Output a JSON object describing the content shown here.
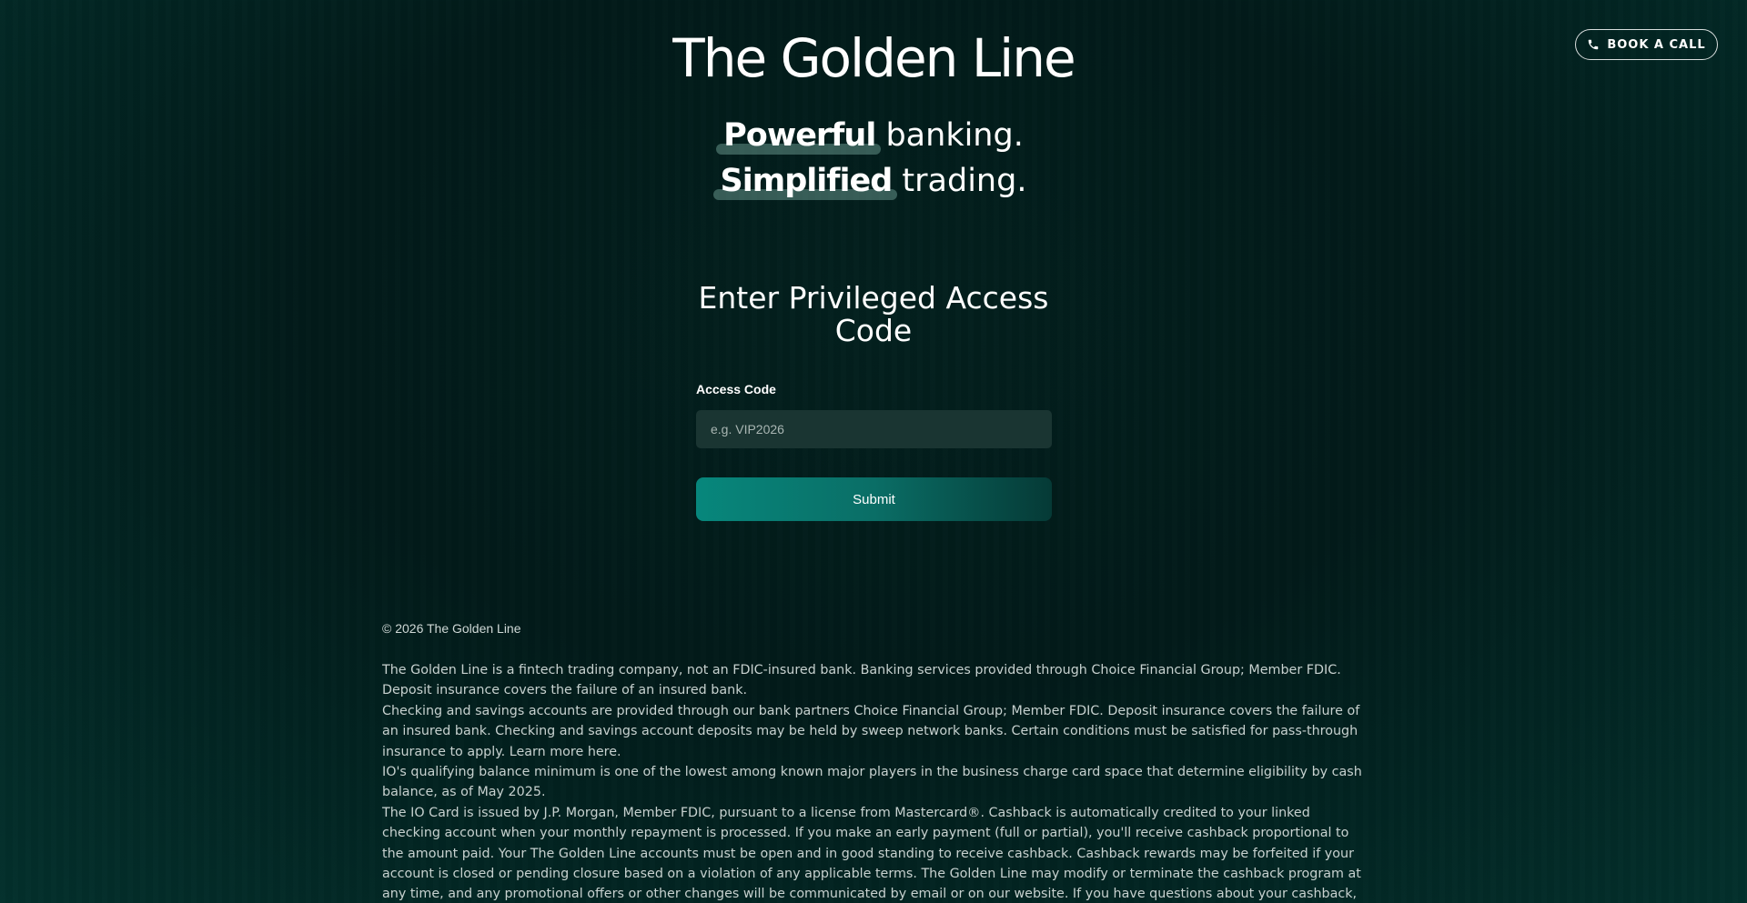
{
  "header": {
    "book_call_label": "BOOK A CALL",
    "brand_title": "The Golden Line"
  },
  "tagline": {
    "line1_highlight": "Powerful",
    "line1_rest": "banking.",
    "line2_highlight": "Simplified",
    "line2_rest": "trading."
  },
  "access_form": {
    "title": "Enter Privileged Access Code",
    "field_label": "Access Code",
    "placeholder": "e.g. VIP2026",
    "value": "",
    "submit_label": "Submit"
  },
  "footer": {
    "copyright": "© 2026 The Golden Line",
    "disclaimers": [
      "The Golden Line is a fintech trading company, not an FDIC-insured bank. Banking services provided through Choice Financial Group; Member FDIC. Deposit insurance covers the failure of an insured bank.",
      "Checking and savings accounts are provided through our bank partners Choice Financial Group; Member FDIC. Deposit insurance covers the failure of an insured bank. Checking and savings account deposits may be held by sweep network banks. Certain conditions must be satisfied for pass-through insurance to apply. Learn more here.",
      "IO's qualifying balance minimum is one of the lowest among known major players in the business charge card space that determine eligibility by cash balance, as of May 2025.",
      "The IO Card is issued by J.P. Morgan, Member FDIC, pursuant to a license from Mastercard®. Cashback is automatically credited to your linked checking account when your monthly repayment is processed. If you make an early payment (full or partial), you'll receive cashback proportional to the amount paid. Your The Golden Line accounts must be open and in good standing to receive cashback. Cashback rewards may be forfeited if your account is closed or pending closure based on a violation of any applicable terms. The Golden Line may modify or terminate the cashback program at any time, and any promotional offers or other changes will be communicated by email or on our website. If you have questions about your cashback, please contact The"
    ]
  },
  "icons": {
    "phone": "phone-icon"
  },
  "colors": {
    "background": "#02201e",
    "input_bg": "#1a3532",
    "button_start": "#07877c",
    "button_end": "#053a36"
  }
}
